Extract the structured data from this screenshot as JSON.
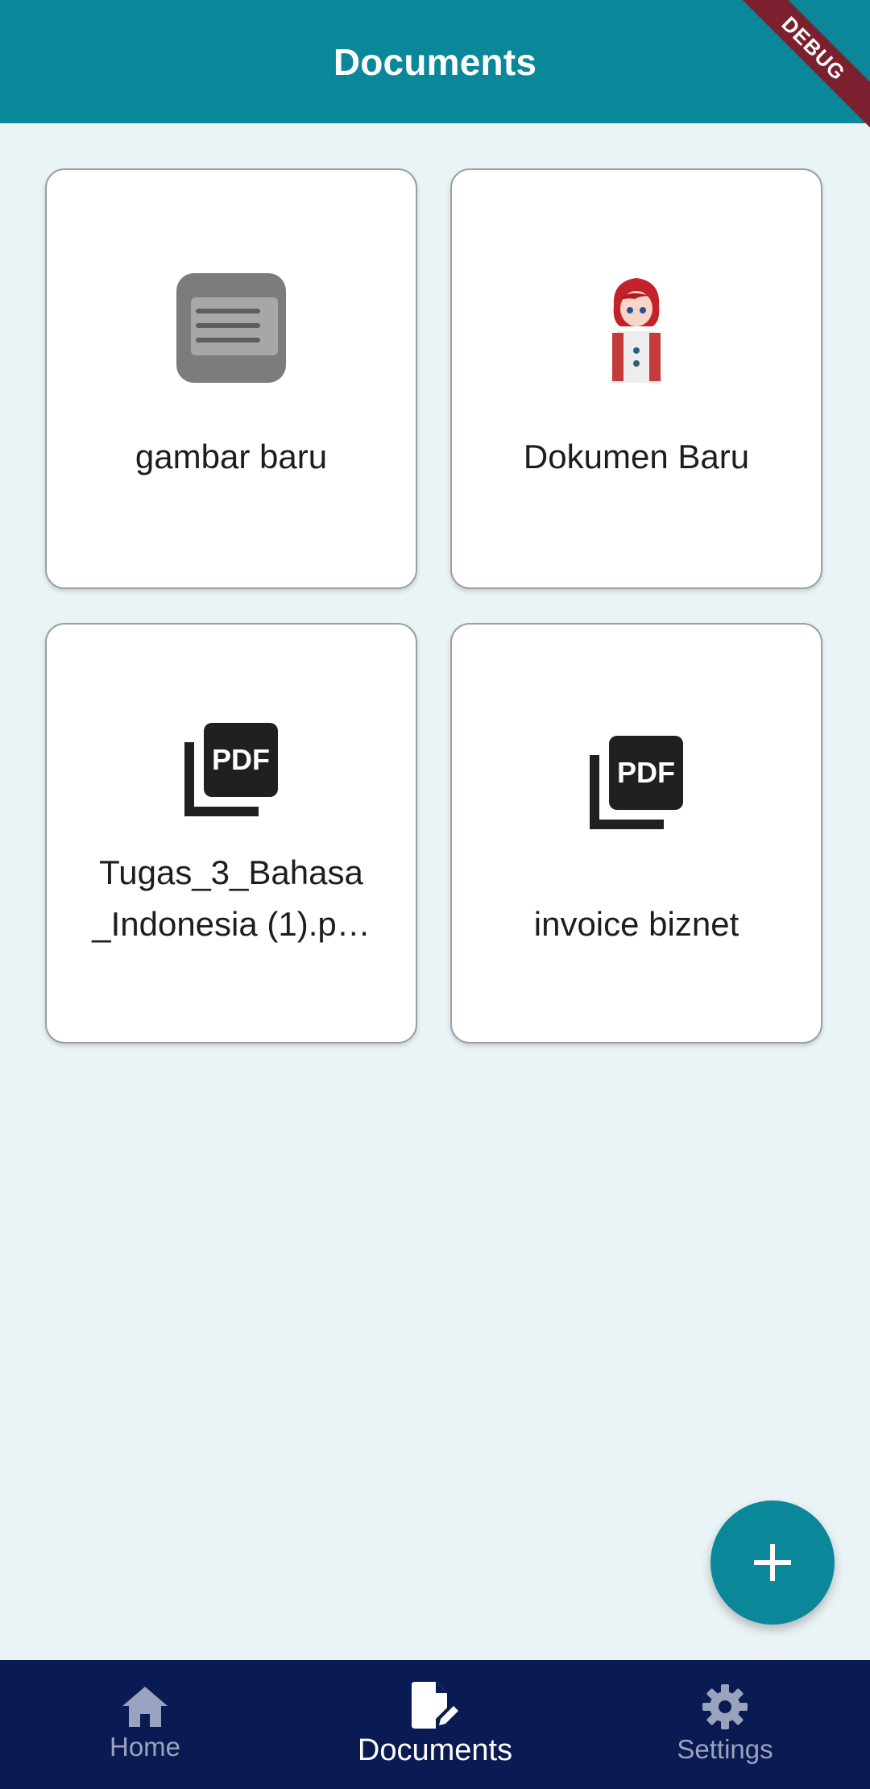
{
  "appbar": {
    "title": "Documents"
  },
  "debug_banner": {
    "text": "DEBUG"
  },
  "documents": [
    {
      "name": "gambar baru",
      "thumb": "screenshot-thumbnail"
    },
    {
      "name": "Dokumen Baru",
      "thumb": "character-avatar"
    },
    {
      "name": "Tugas_3_Bahasa _Indonesia (1).p…",
      "thumb": "pdf-icon"
    },
    {
      "name": "invoice biznet",
      "thumb": "pdf-icon"
    }
  ],
  "fab": {
    "icon": "plus-icon"
  },
  "bottom_nav": {
    "items": [
      {
        "label": "Home",
        "icon": "home-icon",
        "active": false
      },
      {
        "label": "Documents",
        "icon": "document-edit-icon",
        "active": true
      },
      {
        "label": "Settings",
        "icon": "gear-icon",
        "active": false
      }
    ]
  },
  "colors": {
    "primary": "#0A8799",
    "background": "#EAF3F6",
    "nav_background": "#0A1A52",
    "debug": "#7C1F2E"
  }
}
